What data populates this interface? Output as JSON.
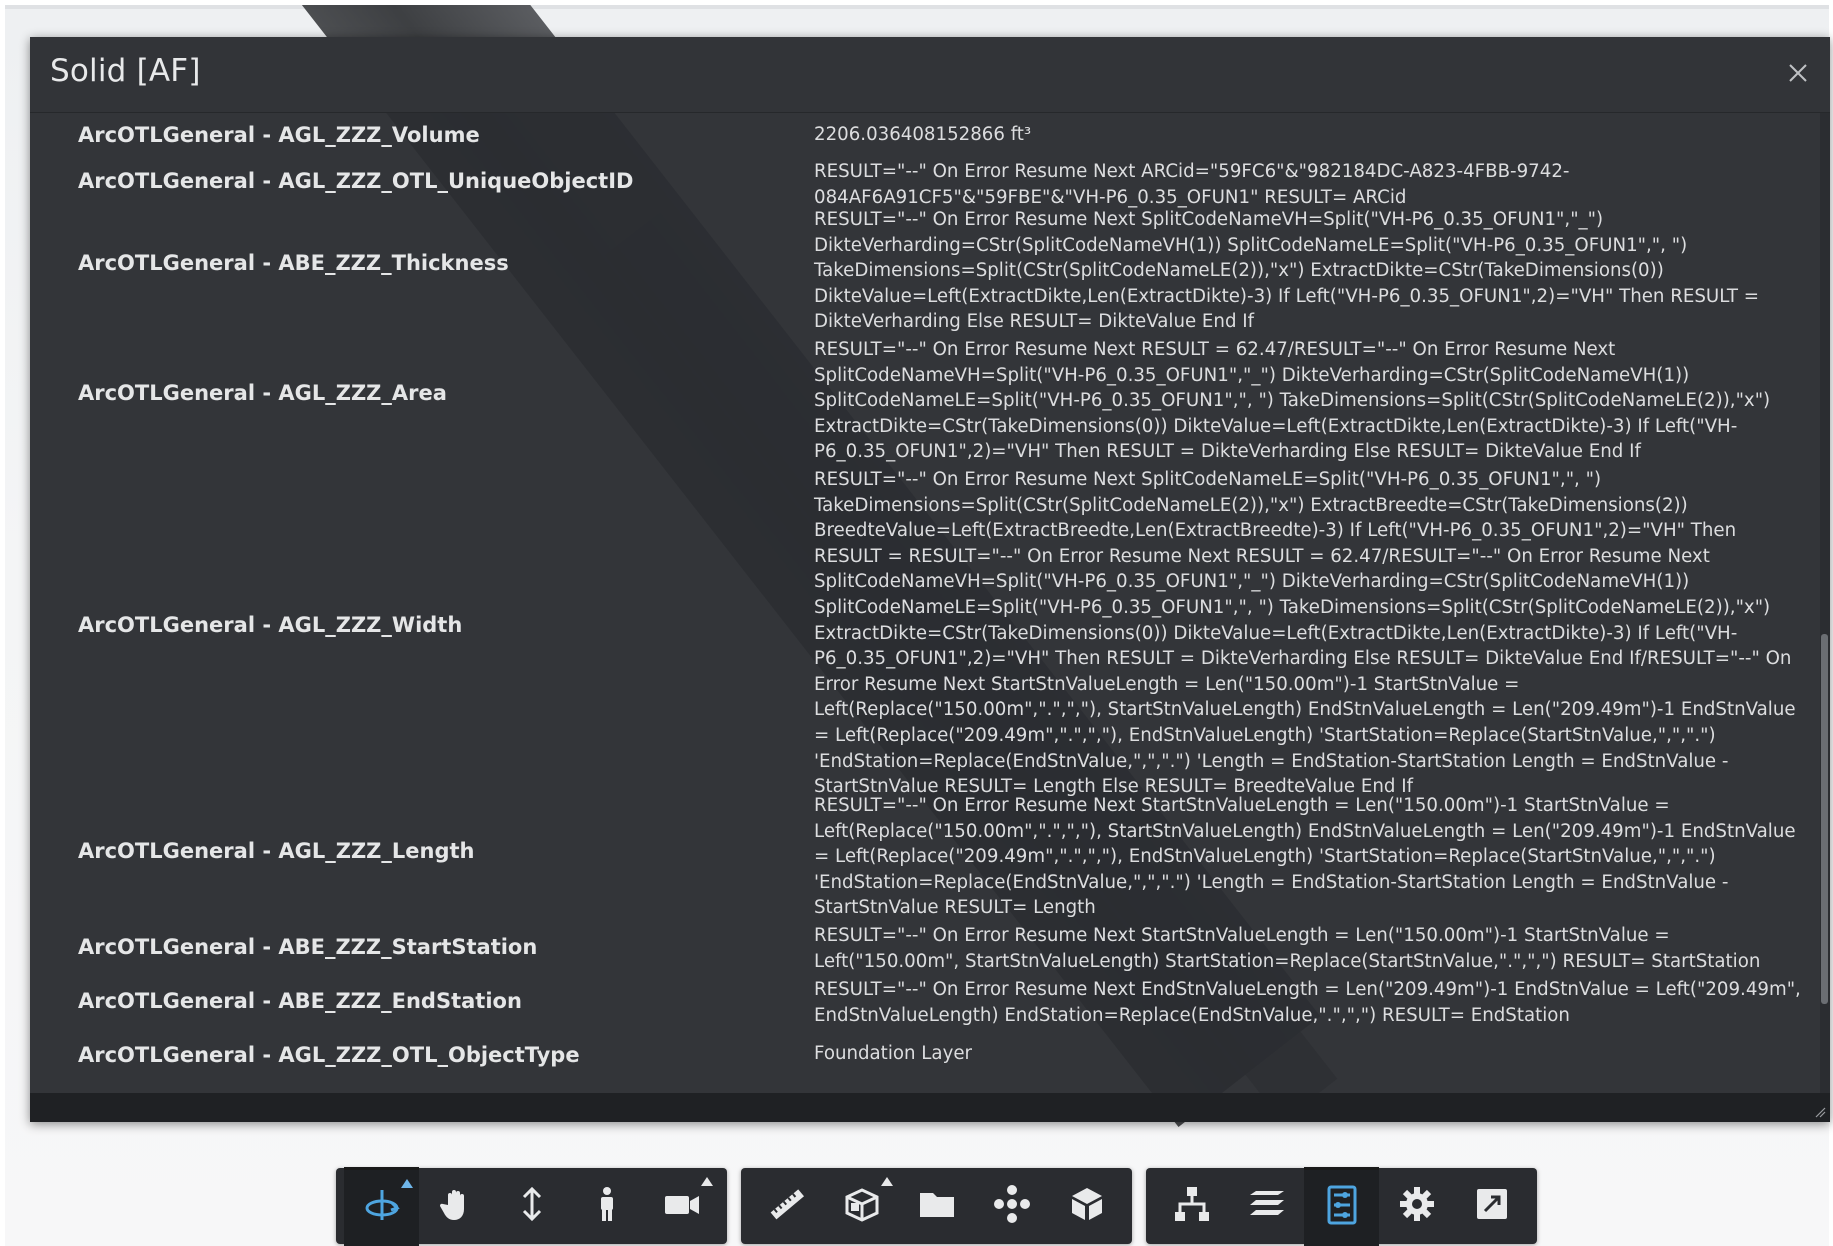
{
  "panel": {
    "title": "Solid [AF]",
    "close_label": "×"
  },
  "properties": [
    {
      "name": "ArcOTLGeneral - AGL_ZZZ_Volume",
      "value": "2206.036408152866 ft³"
    },
    {
      "name": "ArcOTLGeneral - AGL_ZZZ_OTL_UniqueObjectID",
      "value": "RESULT=\"--\" On Error Resume Next ARCid=\"59FC6\"&\"982184DC-A823-4FBB-9742-084AF6A91CF5\"&\"59FBE\"&\"VH-P6_0.35_OFUN1\" RESULT= ARCid"
    },
    {
      "name": "ArcOTLGeneral - ABE_ZZZ_Thickness",
      "value": "RESULT=\"--\" On Error Resume Next SplitCodeNameVH=Split(\"VH-P6_0.35_OFUN1\",\"_\") DikteVerharding=CStr(SplitCodeNameVH(1)) SplitCodeNameLE=Split(\"VH-P6_0.35_OFUN1\",\", \") TakeDimensions=Split(CStr(SplitCodeNameLE(2)),\"x\") ExtractDikte=CStr(TakeDimensions(0)) DikteValue=Left(ExtractDikte,Len(ExtractDikte)-3) If Left(\"VH-P6_0.35_OFUN1\",2)=\"VH\" Then RESULT = DikteVerharding Else RESULT= DikteValue End If"
    },
    {
      "name": "ArcOTLGeneral - AGL_ZZZ_Area",
      "value": "RESULT=\"--\" On Error Resume Next RESULT = 62.47/RESULT=\"--\" On Error Resume Next SplitCodeNameVH=Split(\"VH-P6_0.35_OFUN1\",\"_\") DikteVerharding=CStr(SplitCodeNameVH(1)) SplitCodeNameLE=Split(\"VH-P6_0.35_OFUN1\",\", \") TakeDimensions=Split(CStr(SplitCodeNameLE(2)),\"x\") ExtractDikte=CStr(TakeDimensions(0)) DikteValue=Left(ExtractDikte,Len(ExtractDikte)-3) If Left(\"VH-P6_0.35_OFUN1\",2)=\"VH\" Then RESULT = DikteVerharding Else RESULT= DikteValue End If"
    },
    {
      "name": "ArcOTLGeneral - AGL_ZZZ_Width",
      "value": "RESULT=\"--\" On Error Resume Next SplitCodeNameLE=Split(\"VH-P6_0.35_OFUN1\",\", \") TakeDimensions=Split(CStr(SplitCodeNameLE(2)),\"x\") ExtractBreedte=CStr(TakeDimensions(2)) BreedteValue=Left(ExtractBreedte,Len(ExtractBreedte)-3) If Left(\"VH-P6_0.35_OFUN1\",2)=\"VH\" Then RESULT = RESULT=\"--\" On Error Resume Next RESULT = 62.47/RESULT=\"--\" On Error Resume Next SplitCodeNameVH=Split(\"VH-P6_0.35_OFUN1\",\"_\") DikteVerharding=CStr(SplitCodeNameVH(1)) SplitCodeNameLE=Split(\"VH-P6_0.35_OFUN1\",\", \") TakeDimensions=Split(CStr(SplitCodeNameLE(2)),\"x\") ExtractDikte=CStr(TakeDimensions(0)) DikteValue=Left(ExtractDikte,Len(ExtractDikte)-3) If Left(\"VH-P6_0.35_OFUN1\",2)=\"VH\" Then RESULT = DikteVerharding Else RESULT= DikteValue End If/RESULT=\"--\" On Error Resume Next StartStnValueLength = Len(\"150.00m\")-1 StartStnValue = Left(Replace(\"150.00m\",\".\",\",\"), StartStnValueLength) EndStnValueLength = Len(\"209.49m\")-1 EndStnValue = Left(Replace(\"209.49m\",\".\",\",\"), EndStnValueLength) 'StartStation=Replace(StartStnValue,\",\",\".\") 'EndStation=Replace(EndStnValue,\",\",\".\") 'Length = EndStation-StartStation Length = EndStnValue - StartStnValue RESULT= Length Else RESULT= BreedteValue End If"
    },
    {
      "name": "ArcOTLGeneral - AGL_ZZZ_Length",
      "value": "RESULT=\"--\" On Error Resume Next StartStnValueLength = Len(\"150.00m\")-1 StartStnValue = Left(Replace(\"150.00m\",\".\",\",\"), StartStnValueLength) EndStnValueLength = Len(\"209.49m\")-1 EndStnValue = Left(Replace(\"209.49m\",\".\",\",\"), EndStnValueLength) 'StartStation=Replace(StartStnValue,\",\",\".\") 'EndStation=Replace(EndStnValue,\",\",\".\") 'Length = EndStation-StartStation Length = EndStnValue - StartStnValue RESULT= Length"
    },
    {
      "name": "ArcOTLGeneral - ABE_ZZZ_StartStation",
      "value": "RESULT=\"--\" On Error Resume Next StartStnValueLength = Len(\"150.00m\")-1 StartStnValue = Left(\"150.00m\", StartStnValueLength) StartStation=Replace(StartStnValue,\".\",\",\") RESULT= StartStation"
    },
    {
      "name": "ArcOTLGeneral - ABE_ZZZ_EndStation",
      "value": "RESULT=\"--\" On Error Resume Next EndStnValueLength = Len(\"209.49m\")-1 EndStnValue = Left(\"209.49m\", EndStnValueLength) EndStation=Replace(EndStnValue,\".\",\",\") RESULT= EndStation"
    },
    {
      "name": "ArcOTLGeneral - AGL_ZZZ_OTL_ObjectType",
      "value": "Foundation Layer"
    }
  ],
  "toolbar": {
    "groups": [
      [
        {
          "icon": "orbit-icon",
          "name": "orbit-tool",
          "active": true,
          "caret": true
        },
        {
          "icon": "pan-hand-icon",
          "name": "pan-tool",
          "active": false,
          "caret": false
        },
        {
          "icon": "zoom-arrows-icon",
          "name": "zoom-tool",
          "active": false,
          "caret": false
        },
        {
          "icon": "first-person-icon",
          "name": "first-person-tool",
          "active": false,
          "caret": false
        },
        {
          "icon": "camera-icon",
          "name": "camera-tool",
          "active": false,
          "caret": true
        }
      ],
      [
        {
          "icon": "ruler-icon",
          "name": "measure-tool",
          "active": false,
          "caret": false
        },
        {
          "icon": "section-box-icon",
          "name": "section-tool",
          "active": false,
          "caret": true
        },
        {
          "icon": "folder-icon",
          "name": "model-browser-tool",
          "active": false,
          "caret": false
        },
        {
          "icon": "explode-icon",
          "name": "explode-tool",
          "active": false,
          "caret": false
        },
        {
          "icon": "cube-icon",
          "name": "view-cube-tool",
          "active": false,
          "caret": false
        }
      ],
      [
        {
          "icon": "structure-tree-icon",
          "name": "structure-tool",
          "active": false,
          "caret": false
        },
        {
          "icon": "layers-icon",
          "name": "layers-tool",
          "active": false,
          "caret": false
        },
        {
          "icon": "properties-icon",
          "name": "properties-tool",
          "active": true,
          "caret": false
        },
        {
          "icon": "gear-icon",
          "name": "settings-tool",
          "active": false,
          "caret": false
        },
        {
          "icon": "fullscreen-icon",
          "name": "fullscreen-tool",
          "active": false,
          "caret": false
        }
      ]
    ]
  },
  "colors": {
    "panel_bg": "#2b2d31",
    "accent_blue": "#4ea5e0",
    "text": "#e5e6e7"
  }
}
